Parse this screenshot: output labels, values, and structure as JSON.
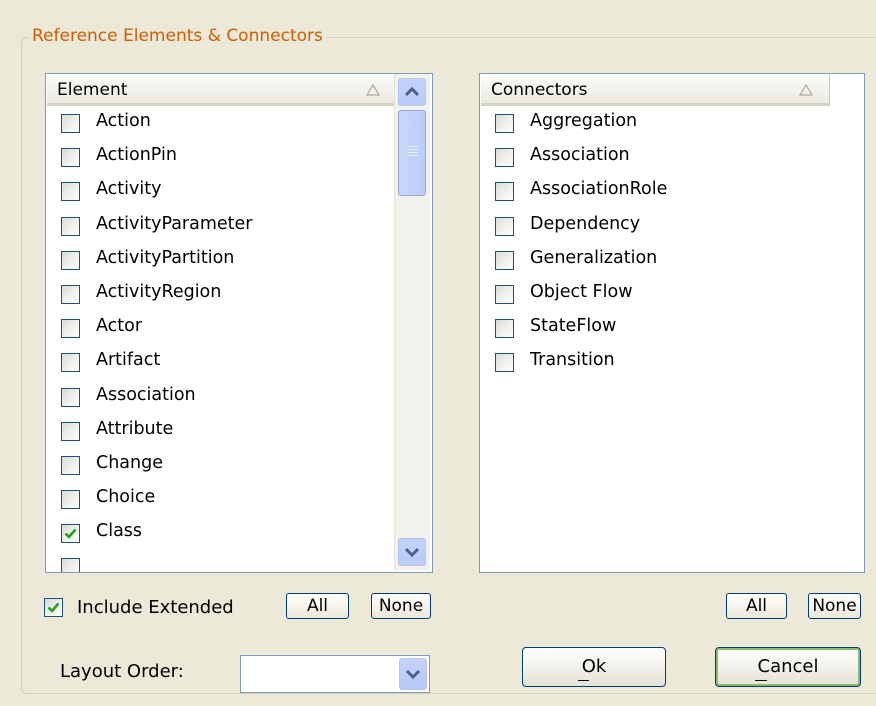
{
  "group": {
    "title": "Reference Elements & Connectors"
  },
  "elements": {
    "header": "Element",
    "items": [
      {
        "label": "Action",
        "checked": false
      },
      {
        "label": "ActionPin",
        "checked": false
      },
      {
        "label": "Activity",
        "checked": false
      },
      {
        "label": "ActivityParameter",
        "checked": false
      },
      {
        "label": "ActivityPartition",
        "checked": false
      },
      {
        "label": "ActivityRegion",
        "checked": false
      },
      {
        "label": "Actor",
        "checked": false
      },
      {
        "label": "Artifact",
        "checked": false
      },
      {
        "label": "Association",
        "checked": false
      },
      {
        "label": "Attribute",
        "checked": false
      },
      {
        "label": "Change",
        "checked": false
      },
      {
        "label": "Choice",
        "checked": false
      },
      {
        "label": "Class",
        "checked": true
      }
    ]
  },
  "connectors": {
    "header": "Connectors",
    "items": [
      {
        "label": "Aggregation",
        "checked": false
      },
      {
        "label": "Association",
        "checked": false
      },
      {
        "label": "AssociationRole",
        "checked": false
      },
      {
        "label": "Dependency",
        "checked": false
      },
      {
        "label": "Generalization",
        "checked": false
      },
      {
        "label": "Object Flow",
        "checked": false
      },
      {
        "label": "StateFlow",
        "checked": false
      },
      {
        "label": "Transition",
        "checked": false
      }
    ]
  },
  "include_extended": {
    "label": "Include Extended",
    "checked": true
  },
  "left_all_label": "All",
  "left_none_label": "None",
  "right_all_label": "All",
  "right_none_label": "None",
  "layout_order": {
    "label": "Layout Order:",
    "value": ""
  },
  "ok_label": "Ok",
  "cancel_label": "Cancel",
  "colors": {
    "title": "#d35b00",
    "check": "#21a121",
    "face": "#ece9d8",
    "border": "#7f9db9"
  }
}
